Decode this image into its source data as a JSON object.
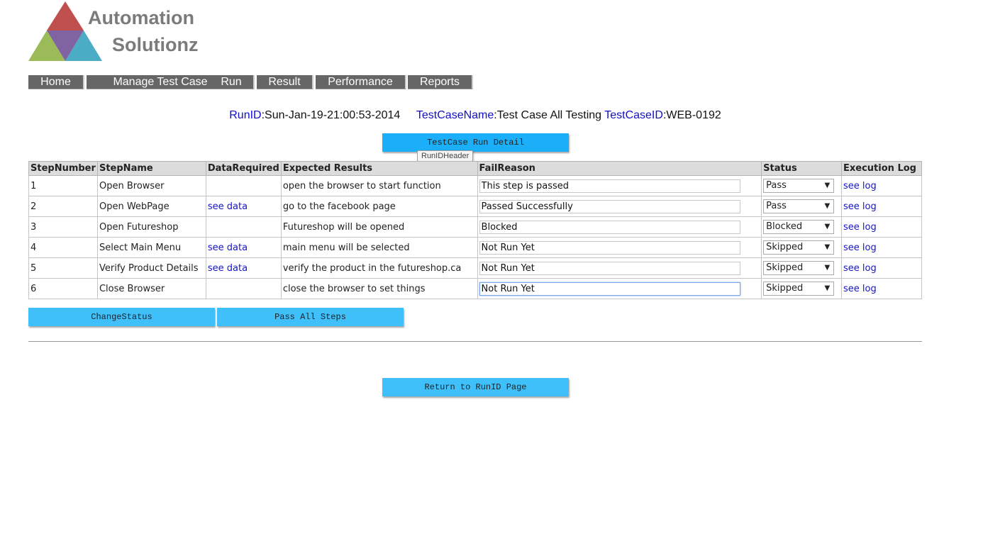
{
  "brand": {
    "line1": "Automation",
    "line2": "Solutionz",
    "colors": {
      "red": "#c0504d",
      "green": "#9bbb59",
      "purple": "#8064a2",
      "teal": "#4bacc6"
    }
  },
  "nav": {
    "items": [
      "Home",
      "Manage Test Case",
      "Run",
      "Result",
      "Performance",
      "Reports"
    ]
  },
  "run_info": {
    "run_id_label": "RunID",
    "run_id_value": "Sun-Jan-19-21:00:53-2014",
    "test_case_name_label": "TestCaseName",
    "test_case_name_value": "Test Case All Testing",
    "test_case_id_label": "TestCaseID",
    "test_case_id_value": "WEB-0192",
    "separator": ":"
  },
  "detail_button": "TestCase Run Detail",
  "tooltip": "RunIDHeader",
  "table": {
    "headers": [
      "StepNumber",
      "StepName",
      "DataRequired",
      "Expected Results",
      "FailReason",
      "Status",
      "Execution Log"
    ],
    "rows": [
      {
        "step": "1",
        "name": "Open Browser",
        "data": "",
        "expected": "open the browser to start function",
        "fail_reason": "This step is passed",
        "status": "Pass",
        "log": "see log"
      },
      {
        "step": "2",
        "name": "Open WebPage",
        "data": "see data",
        "expected": "go to the facebook page",
        "fail_reason": "Passed Successfully",
        "status": "Pass",
        "log": "see log"
      },
      {
        "step": "3",
        "name": "Open Futureshop",
        "data": "",
        "expected": "Futureshop will be opened",
        "fail_reason": "Blocked",
        "status": "Blocked",
        "log": "see log"
      },
      {
        "step": "4",
        "name": "Select Main Menu",
        "data": "see data",
        "expected": "main menu will be selected",
        "fail_reason": "Not Run Yet",
        "status": "Skipped",
        "log": "see log"
      },
      {
        "step": "5",
        "name": "Verify Product Details",
        "data": "see data",
        "expected": "verify the product in the futureshop.ca",
        "fail_reason": "Not Run Yet",
        "status": "Skipped",
        "log": "see log"
      },
      {
        "step": "6",
        "name": "Close Browser",
        "data": "",
        "expected": "close the browser to set things",
        "fail_reason": "Not Run Yet",
        "status": "Skipped",
        "log": "see log"
      }
    ]
  },
  "actions": {
    "change_status": "ChangeStatus",
    "pass_all": "Pass All Steps",
    "return": "Return to RunID Page"
  },
  "colors": {
    "nav_bg": "#666666",
    "button_bg": "#3fc0fa",
    "label_blue": "#1010c8",
    "link_blue": "#1515c8"
  }
}
